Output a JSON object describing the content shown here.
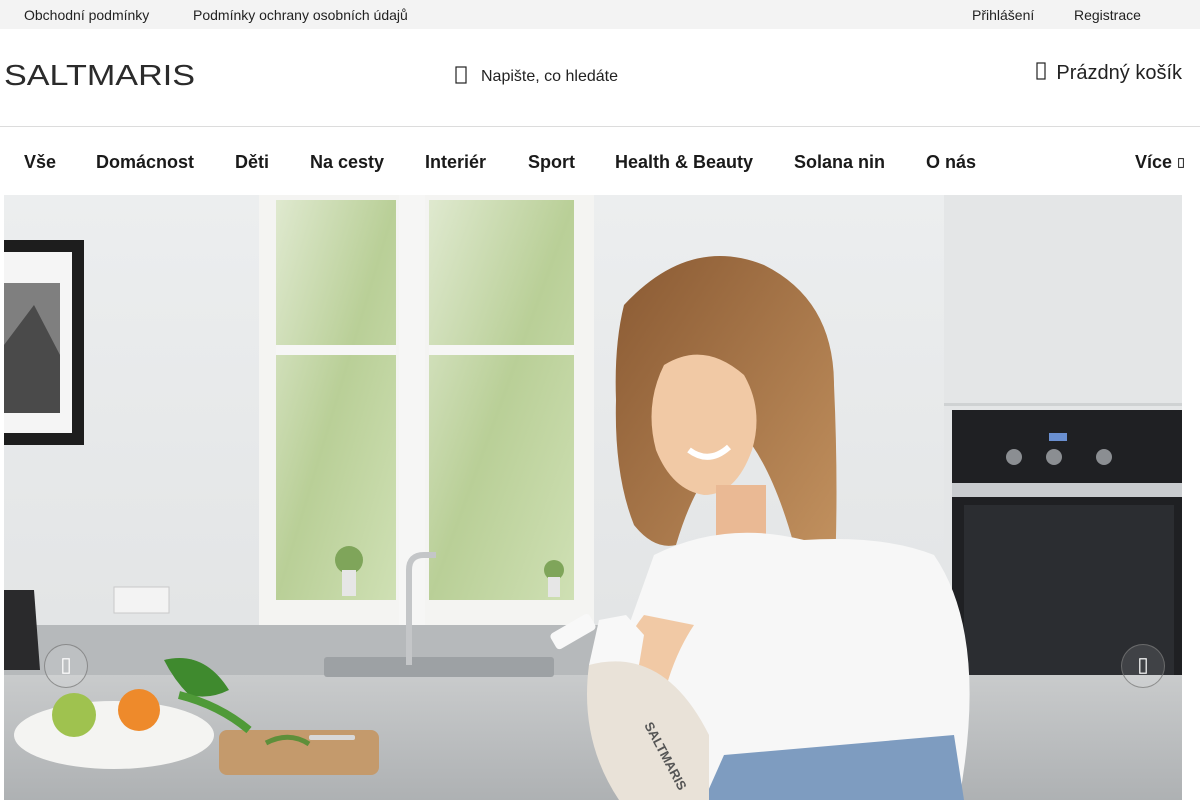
{
  "topbar": {
    "links": {
      "terms": "Obchodní podmínky",
      "privacy": "Podmínky ochrany osobních údajů",
      "login": "Přihlášení",
      "register": "Registrace"
    }
  },
  "header": {
    "logo_text": "SALTMARIS",
    "search_placeholder": "Napište, co hledáte",
    "cart_label": "Prázdný košík"
  },
  "nav": {
    "items": [
      "Vše",
      "Domácnost",
      "Děti",
      "Na cesty",
      "Interiér",
      "Sport",
      "Health & Beauty",
      "Solana nin",
      "O nás"
    ],
    "more_label": "Více"
  },
  "hero": {
    "image_icon": "hero-photo",
    "bottle_label": "SALTMARIS"
  },
  "icons": {
    "search": "search-icon",
    "cart": "cart-icon",
    "more": "chevron-down-icon",
    "prev": "chevron-left-icon",
    "next": "chevron-right-icon"
  },
  "colors": {
    "topbar_bg": "#f3f3f3",
    "text": "#1a1a1a",
    "border": "#dcdcdc"
  }
}
